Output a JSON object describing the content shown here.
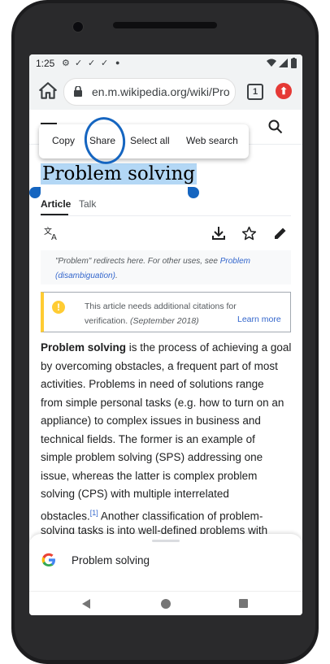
{
  "statusbar": {
    "time": "1:25"
  },
  "browser": {
    "url": "en.m.wikipedia.org/wiki/Pro",
    "tab_count": "1"
  },
  "context_menu": {
    "items": [
      "Copy",
      "Share",
      "Select all",
      "Web search"
    ]
  },
  "article": {
    "title": "Problem solving",
    "tabs": [
      "Article",
      "Talk"
    ],
    "hatnote": {
      "lead": "\"Problem\" redirects here. For other uses, see",
      "link1": "Problem",
      "link2": "(disambiguation)",
      "tail": "."
    },
    "ambox": {
      "line1": "This article needs additional citations for",
      "line2": "verification.",
      "date": "(September 2018)",
      "learn_more": "Learn more"
    },
    "body": {
      "bold_lead": "Problem solving",
      "line1_rest": " is the process of achieving a goal",
      "lines": [
        "by overcoming obstacles, a frequent part of most",
        "activities. Problems in need of solutions range",
        "from simple personal tasks (e.g. how to turn on an",
        "appliance) to complex issues in business and",
        "technical fields. The former is an example of",
        "simple problem solving (SPS) addressing one",
        "issue, whereas the latter is complex problem",
        "solving (CPS) with multiple interrelated"
      ],
      "line_obstacles": "obstacles.",
      "citation": "[1]",
      "line_obstacles_rest": " Another classification of problem-",
      "last_line": "solving tasks is into well-defined problems with"
    }
  },
  "bottom_sheet": {
    "text": "Problem solving"
  },
  "colors": {
    "selection": "#b3d7f5",
    "handle": "#1565c0",
    "link": "#3366cc",
    "ambox_accent": "#ffcc33"
  }
}
